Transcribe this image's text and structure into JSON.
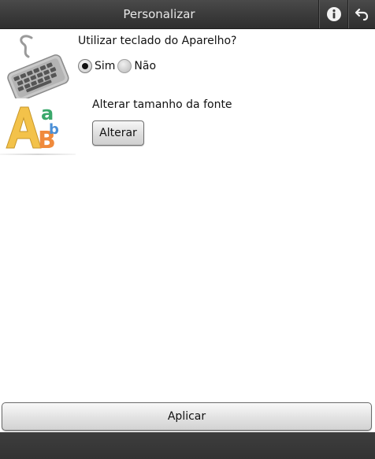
{
  "header": {
    "title": "Personalizar",
    "info_icon": "info-icon",
    "back_icon": "back-arrow-icon"
  },
  "illustration": {
    "keyboard_icon": "keyboard-icon",
    "font_letters_icon": "font-letters-icon"
  },
  "keyboard_setting": {
    "question": "Utilizar teclado do Aparelho?",
    "options": [
      {
        "label": "Sim",
        "selected": true
      },
      {
        "label": "Não",
        "selected": false
      }
    ]
  },
  "font_setting": {
    "label": "Alterar tamanho da fonte",
    "button_label": "Alterar"
  },
  "footer": {
    "apply_label": "Aplicar"
  },
  "colors": {
    "topbar": "#3a3a3a",
    "bottombar": "#363636",
    "text": "#111111",
    "header_text": "#e8e8e8"
  }
}
